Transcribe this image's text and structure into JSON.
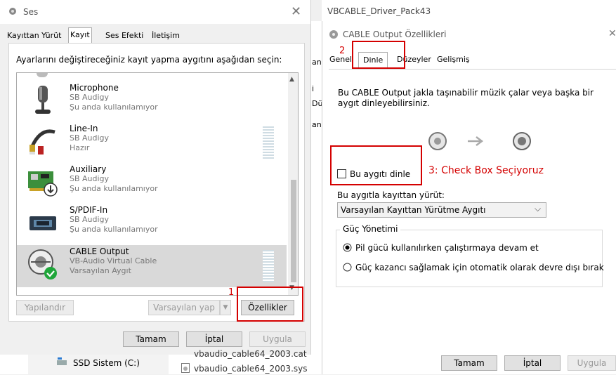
{
  "ses": {
    "title": "Ses",
    "tabs": [
      "Kayıttan Yürüt",
      "Kayıt",
      "Ses Efekti",
      "İletişim"
    ],
    "instruction": "Ayarlarını değiştireceğiniz kayıt yapma aygıtını aşağıdan seçin:",
    "devices": [
      {
        "name": "Microphone",
        "driver": "SB Audigy",
        "status": "Şu anda kullanılamıyor"
      },
      {
        "name": "Line-In",
        "driver": "SB Audigy",
        "status": "Hazır"
      },
      {
        "name": "Auxiliary",
        "driver": "SB Audigy",
        "status": "Şu anda kullanılamıyor"
      },
      {
        "name": "S/PDIF-In",
        "driver": "SB Audigy",
        "status": "Şu anda kullanılamıyor"
      },
      {
        "name": "CABLE Output",
        "driver": "VB-Audio Virtual Cable",
        "status": "Varsayılan Aygıt"
      }
    ],
    "buttons": {
      "configure": "Yapılandır",
      "set_default": "Varsayılan yap",
      "properties": "Özellikler"
    },
    "footer": {
      "ok": "Tamam",
      "cancel": "İptal",
      "apply": "Uygula"
    },
    "annotation_1": "1"
  },
  "behind": {
    "drive": "SSD Sistem (C:)",
    "file_partial": "vbaudio_cable64_2003.cat",
    "file": "vbaudio_cable64_2003.sys"
  },
  "right_window": {
    "title": "VBCABLE_Driver_Pack43",
    "behind_fragments": [
      "an",
      "i",
      "Dü",
      "an"
    ]
  },
  "cable": {
    "title": "CABLE Output Özellikleri",
    "tabs": [
      "Genel",
      "Dinle",
      "Düzeyler",
      "Gelişmiş"
    ],
    "annotation_2": "2",
    "description": "Bu CABLE Output jakla taşınabilir müzik çalar veya başka bir aygıt dinleyebilirsiniz.",
    "checkbox_label": "Bu aygıtı dinle",
    "annotation_3": "3: Check Box Seçiyoruz",
    "playback_label": "Bu aygıtla kayıttan yürüt:",
    "playback_value": "Varsayılan Kayıttan Yürütme Aygıtı",
    "power_group": "Güç Yönetimi",
    "radio1": "Pil gücü kullanılırken çalıştırmaya devam et",
    "radio2": "Güç kazancı sağlamak için otomatik olarak devre dışı bırak",
    "footer": {
      "ok": "Tamam",
      "cancel": "İptal",
      "apply": "Uygula"
    }
  },
  "colors": {
    "annotation": "#d40000",
    "selection": "#d9d9d9",
    "check_green": "#1fa63a"
  }
}
